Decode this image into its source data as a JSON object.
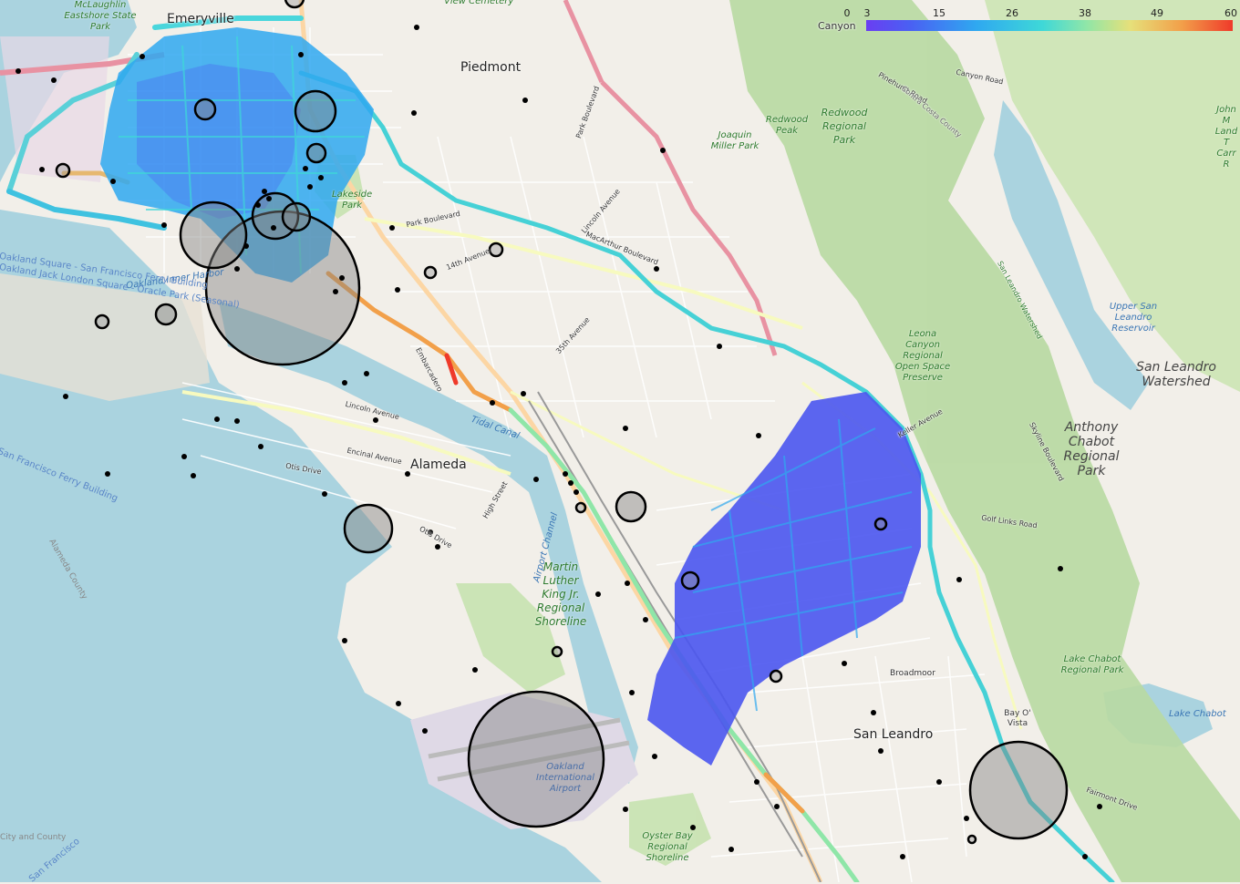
{
  "colorbar": {
    "ticks": [
      "0",
      "3",
      "15",
      "26",
      "38",
      "49",
      "60"
    ],
    "colors": [
      "#6a3ef2",
      "#4a60f3",
      "#2fa8f0",
      "#3ed8d8",
      "#8fe6a8",
      "#e6e07a",
      "#f2a04a",
      "#ef3a2a"
    ]
  },
  "labels": {
    "emeryville": "Emeryville",
    "piedmont": "Piedmont",
    "alameda": "Alameda",
    "san_leandro": "San Leandro",
    "canyon": "Canyon",
    "mclaughlin": "McLaughlin Eastshore State Park",
    "view_cemetery": "View Cemetery",
    "redwood_peak": "Redwood Peak",
    "redwood_park": "Redwood Regional Park",
    "joaquin": "Joaquin Miller Park",
    "lakeside": "Lakeside Park",
    "john_muir": "John M Land T Carr R",
    "upper_reservoir": "Upper San Leandro Reservoir",
    "sl_watershed": "San Leandro Watershed",
    "anthony_chabot": "Anthony Chabot Regional Park",
    "leona": "Leona Canyon Regional Open Space Preserve",
    "mlk": "Martin Luther King Jr. Regional Shoreline",
    "lake_chabot_park": "Lake Chabot Regional Park",
    "lake_chabot": "Lake Chabot",
    "bay_o_vista": "Bay O' Vista",
    "broadmoor": "Broadmoor",
    "airport": "Oakland International Airport",
    "oyster_bay": "Oyster Bay Regional Shoreline",
    "oakland_inner_harbor": "Oakland Inner Harbor",
    "tidal_canal": "Tidal Canal",
    "airport_channel": "Airport Channel",
    "sf_ferry_1": "Oakland Square - San Francisco Ferry Building",
    "sf_ferry_2": "Oakland Jack London Square - Oracle Park (Seasonal)",
    "sf_ferry_3": "San Francisco Ferry Building",
    "alameda_county": "Alameda County",
    "city_county": "City and County",
    "san_francisco": "San Francisco",
    "park_blvd": "Park Boulevard",
    "park_blvd_2": "Park Boulevard",
    "ave_14": "14th Avenue",
    "lincoln_ave": "Lincoln Avenue",
    "macarthur": "MacArthur Boulevard",
    "ave_35": "35th Avenue",
    "embarcadero": "Embarcadero",
    "lincoln_ave_2": "Lincoln Avenue",
    "encinal": "Encinal Avenue",
    "otis": "Otis Drive",
    "otis_2": "Otis Drive",
    "high_st": "High Street",
    "canyon_rd": "Canyon Road",
    "pinehurst": "Pinehurst Road",
    "contra_costa": "Contra Costa County",
    "sl_watershed_rd": "San Leandro Watershed",
    "skyline": "Skyline Boulevard",
    "golf_links": "Golf Links Road",
    "keller": "Keller Avenue",
    "fairmont": "Fairmont Drive"
  }
}
